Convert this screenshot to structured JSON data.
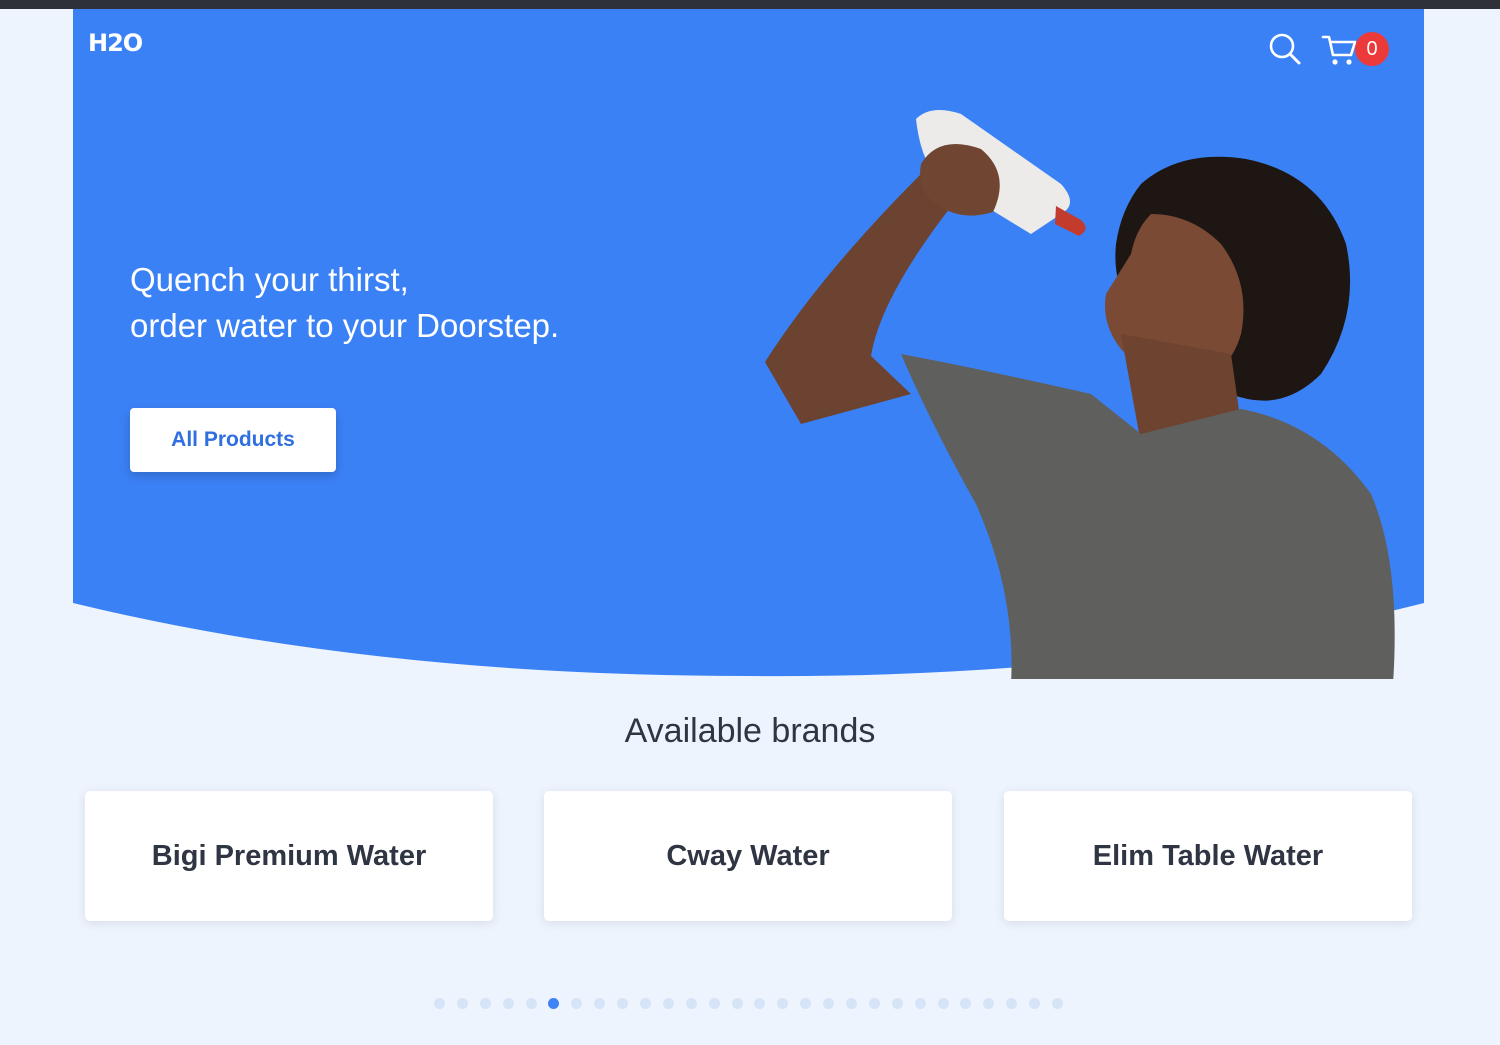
{
  "header": {
    "logo_text": "H2O",
    "cart_count": "0"
  },
  "hero": {
    "headline_line1": "Quench your thirst,",
    "headline_line2": "order water to your Doorstep.",
    "cta_label": "All Products",
    "image": "man-drinking-from-water-bottle",
    "bg_color": "#3b81f6"
  },
  "brands": {
    "title": "Available brands",
    "items": [
      {
        "label": "Bigi Premium Water"
      },
      {
        "label": "Cway Water"
      },
      {
        "label": "Elim Table Water"
      }
    ]
  },
  "pagination": {
    "total": 28,
    "active_index": 5
  },
  "colors": {
    "accent": "#3b81f6",
    "badge": "#ec3a3a",
    "page_bg": "#eef4fd",
    "text_dark": "#2f3542"
  }
}
